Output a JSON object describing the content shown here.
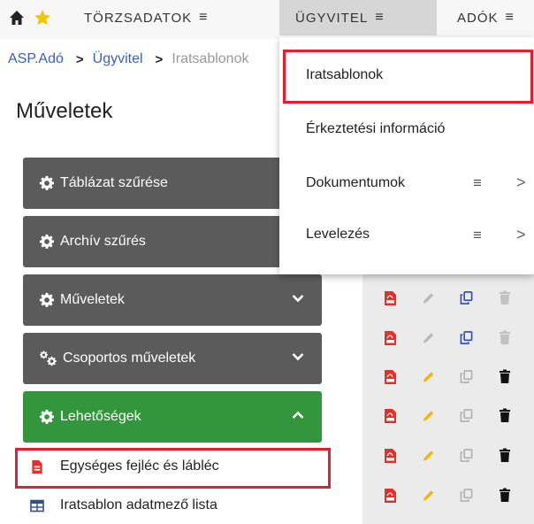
{
  "topnav": {
    "home_icon": "home-icon",
    "star_icon": "star-icon",
    "menus": [
      {
        "label": "TÖRZSADATOK",
        "hamburger": "≡"
      },
      {
        "label": "ÜGYVITEL",
        "hamburger": "≡"
      },
      {
        "label": "ADÓK",
        "hamburger": "≡"
      }
    ]
  },
  "breadcrumb": {
    "items": [
      "ASP.Adó",
      "Ügyvitel",
      "Iratsablonok"
    ],
    "separator": ">"
  },
  "page": {
    "title": "Műveletek"
  },
  "sidebar": {
    "buttons": [
      {
        "label": "Táblázat szűrése",
        "icon": "gear-icon",
        "chevron": ""
      },
      {
        "label": "Archív szűrés",
        "icon": "gear-icon",
        "chevron": ""
      },
      {
        "label": "Műveletek",
        "icon": "gear-icon",
        "chevron": "down"
      },
      {
        "label": "Csoportos műveletek",
        "icon": "gears-icon",
        "chevron": "down"
      },
      {
        "label": "Lehetőségek",
        "icon": "gear-icon",
        "chevron": "up"
      }
    ],
    "subitems": [
      {
        "label": "Egységes fejléc és lábléc",
        "icon": "document-icon"
      },
      {
        "label": "Iratsablon adatmező lista",
        "icon": "table-icon"
      }
    ]
  },
  "dropdown": {
    "items": [
      {
        "label": "Iratsablonok",
        "has_submenu": false
      },
      {
        "label": "Érkeztetési információ",
        "has_submenu": false
      },
      {
        "label": "Dokumentumok",
        "has_submenu": true,
        "hamburger": "≡",
        "chevron": ">"
      },
      {
        "label": "Levelezés",
        "has_submenu": true,
        "hamburger": "≡",
        "chevron": ">"
      }
    ]
  },
  "table_actions": {
    "rows": [
      {
        "pdf": "pdf-icon",
        "edit_enabled": false,
        "copy_enabled": true,
        "delete_enabled": false
      },
      {
        "pdf": "pdf-icon",
        "edit_enabled": false,
        "copy_enabled": true,
        "delete_enabled": false
      },
      {
        "pdf": "pdf-icon",
        "edit_enabled": true,
        "copy_enabled": false,
        "delete_enabled": true
      },
      {
        "pdf": "pdf-icon",
        "edit_enabled": true,
        "copy_enabled": false,
        "delete_enabled": true
      },
      {
        "pdf": "pdf-icon",
        "edit_enabled": true,
        "copy_enabled": false,
        "delete_enabled": true
      },
      {
        "pdf": "pdf-icon",
        "edit_enabled": true,
        "copy_enabled": false,
        "delete_enabled": true
      }
    ]
  },
  "colors": {
    "dark_button": "#5b5b5b",
    "green_button": "#34963c",
    "highlight": "#e0202a",
    "link": "#3a5fbd",
    "pdf_red": "#e5302a",
    "pencil_yellow": "#f2b600",
    "copy_blue": "#2a48c8"
  }
}
